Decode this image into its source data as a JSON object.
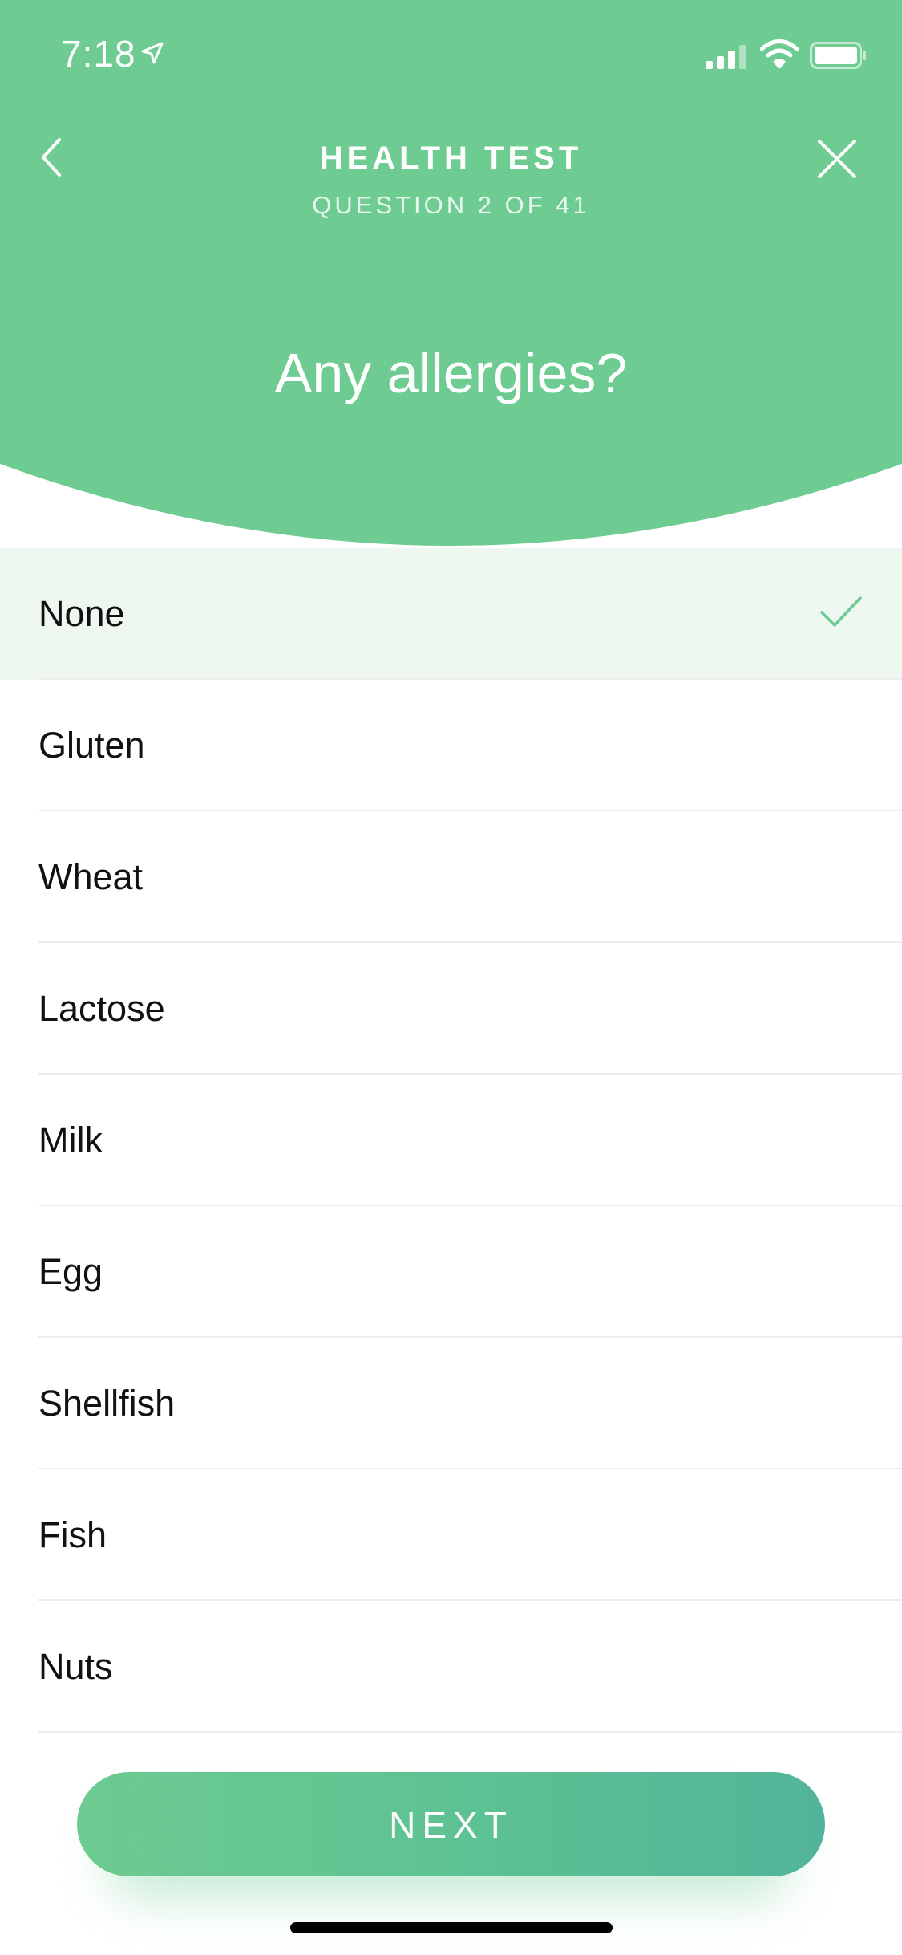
{
  "colors": {
    "header_green": "#6ecb91",
    "selected_row_bg": "#eef8f1",
    "check_green": "#6ecb91",
    "button_gradient_start": "#6ecb91",
    "button_gradient_end": "#52b49a"
  },
  "status_bar": {
    "time": "7:18",
    "icons": [
      "location-arrow-icon",
      "cellular-signal-icon",
      "wifi-icon",
      "battery-icon"
    ]
  },
  "nav": {
    "back_icon": "chevron-left-icon",
    "close_icon": "close-icon",
    "title": "HEALTH TEST",
    "subtitle": "QUESTION 2 OF 41"
  },
  "question": {
    "text": "Any allergies?"
  },
  "options": [
    {
      "label": "None",
      "selected": true
    },
    {
      "label": "Gluten",
      "selected": false
    },
    {
      "label": "Wheat",
      "selected": false
    },
    {
      "label": "Lactose",
      "selected": false
    },
    {
      "label": "Milk",
      "selected": false
    },
    {
      "label": "Egg",
      "selected": false
    },
    {
      "label": "Shellfish",
      "selected": false
    },
    {
      "label": "Fish",
      "selected": false
    },
    {
      "label": "Nuts",
      "selected": false
    }
  ],
  "footer": {
    "next_label": "NEXT"
  }
}
